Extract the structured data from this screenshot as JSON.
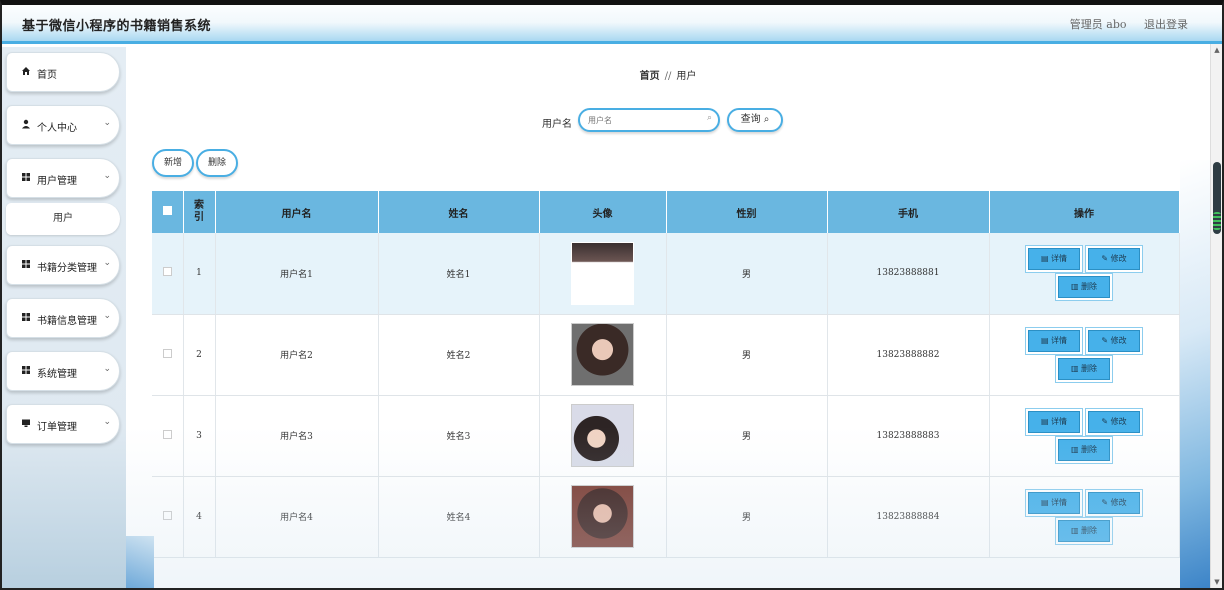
{
  "header": {
    "title": "基于微信小程序的书籍销售系统",
    "admin": "管理员 abo",
    "logout": "退出登录"
  },
  "sidebar": {
    "items": [
      {
        "label": "首页",
        "icon": "home-icon"
      },
      {
        "label": "个人中心",
        "icon": "user-icon"
      },
      {
        "label": "用户管理",
        "icon": "grid-icon"
      },
      {
        "label": "书籍分类管理",
        "icon": "grid-icon"
      },
      {
        "label": "书籍信息管理",
        "icon": "grid-icon"
      },
      {
        "label": "系统管理",
        "icon": "grid-icon"
      },
      {
        "label": "订单管理",
        "icon": "monitor-icon"
      }
    ],
    "sub_item": "用户"
  },
  "breadcrumb": {
    "home": "首页",
    "separator": "//",
    "current": "用户"
  },
  "search": {
    "label": "用户名",
    "placeholder": "用户名",
    "query_button": "查询"
  },
  "toolbar": {
    "add": "新增",
    "delete": "删除"
  },
  "table": {
    "headers": [
      "索引",
      "用户名",
      "姓名",
      "头像",
      "性别",
      "手机",
      "操作"
    ],
    "rows": [
      {
        "index": "1",
        "username": "用户名1",
        "name": "姓名1",
        "gender": "男",
        "phone": "13823888881"
      },
      {
        "index": "2",
        "username": "用户名2",
        "name": "姓名2",
        "gender": "男",
        "phone": "13823888882"
      },
      {
        "index": "3",
        "username": "用户名3",
        "name": "姓名3",
        "gender": "男",
        "phone": "13823888883"
      },
      {
        "index": "4",
        "username": "用户名4",
        "name": "姓名4",
        "gender": "男",
        "phone": "13823888884"
      }
    ],
    "actions": {
      "detail": "详情",
      "edit": "修改",
      "delete": "删除"
    }
  },
  "colors": {
    "accent": "#49aee3",
    "table_header": "#6ab7e0",
    "action_button": "#46b1ea"
  }
}
